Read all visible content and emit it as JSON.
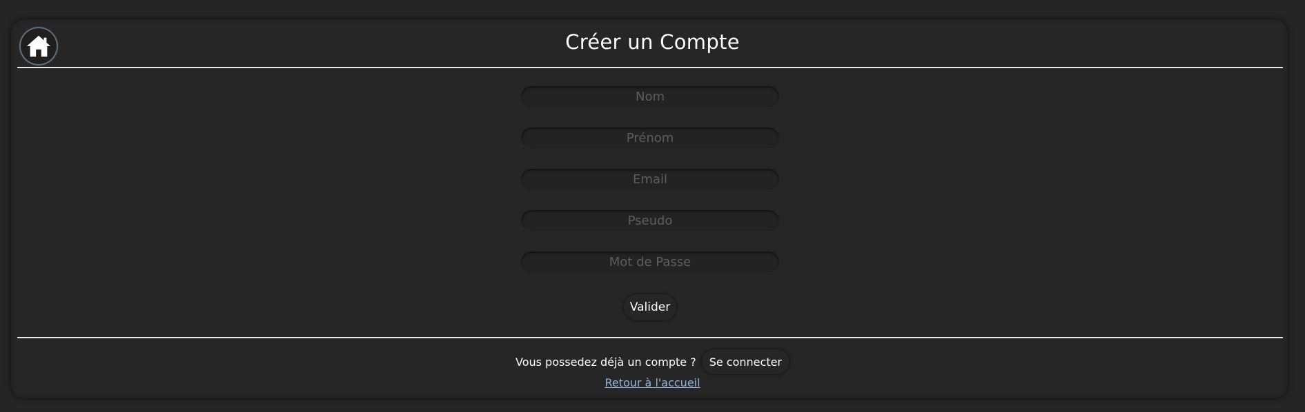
{
  "header": {
    "title": "Créer un Compte",
    "home_icon": "home-icon"
  },
  "form": {
    "fields": [
      {
        "name": "nom",
        "placeholder": "Nom",
        "value": ""
      },
      {
        "name": "prenom",
        "placeholder": "Prénom",
        "value": ""
      },
      {
        "name": "email",
        "placeholder": "Email",
        "value": ""
      },
      {
        "name": "pseudo",
        "placeholder": "Pseudo",
        "value": ""
      },
      {
        "name": "password",
        "placeholder": "Mot de Passe",
        "value": ""
      }
    ],
    "submit_label": "Valider"
  },
  "footer": {
    "question": "Vous possedez déjà un compte ?",
    "login_label": "Se connecter",
    "back_link": "Retour à l'accueil"
  },
  "colors": {
    "background": "#252525",
    "card": "#262626",
    "divider": "#e8e8e8",
    "link": "#8fb4d9",
    "placeholder": "#5e5e5e"
  }
}
